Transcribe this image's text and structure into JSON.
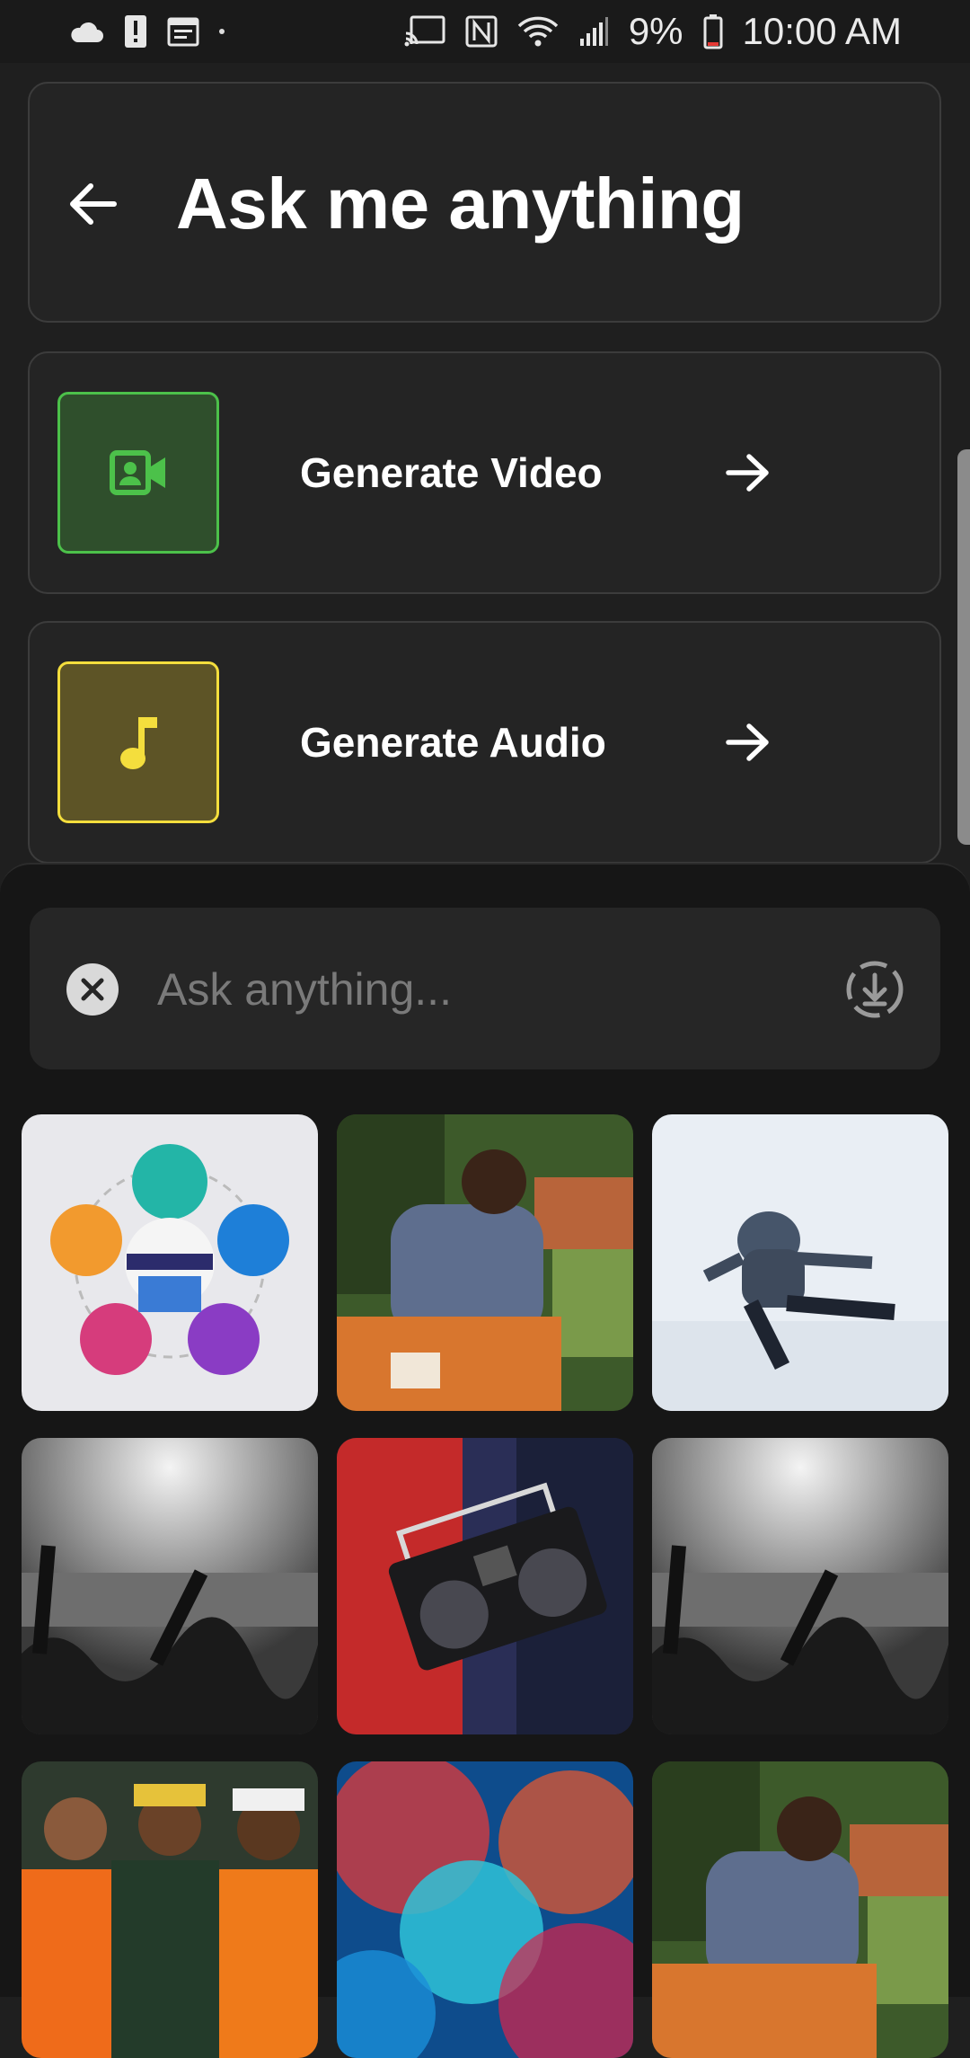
{
  "status_bar": {
    "battery": "9%",
    "time": "10:00 AM",
    "icons": [
      "cloud-icon",
      "alert-icon",
      "calendar-icon",
      "dot-icon",
      "cast-icon",
      "nfc-icon",
      "wifi-icon",
      "signal-icon",
      "battery-icon"
    ]
  },
  "header": {
    "title": "Ask me anything",
    "back_icon": "arrow-left-icon"
  },
  "features": [
    {
      "label": "Generate Video",
      "icon": "video-camera-icon",
      "color": "#4cc14a"
    },
    {
      "label": "Generate Audio",
      "icon": "music-note-icon",
      "color": "#f4de3d"
    }
  ],
  "search": {
    "placeholder": "Ask anything...",
    "value": ""
  },
  "gallery": {
    "tiles": [
      "techable-infographic",
      "man-seated-portrait",
      "dancer-white-room",
      "concert-crowd",
      "boombox-person",
      "concert-crowd",
      "group-streetwear",
      "colorful-smoke",
      "man-seated-portrait"
    ]
  }
}
